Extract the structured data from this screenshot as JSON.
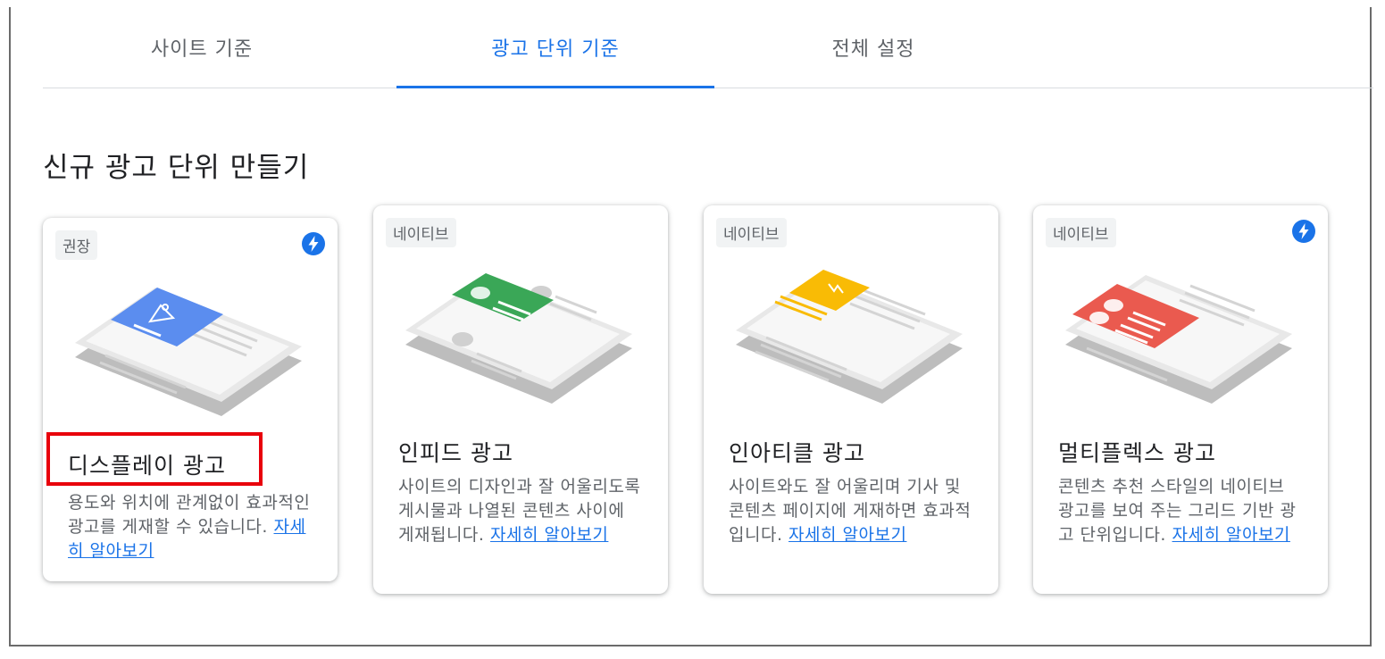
{
  "tabs": [
    {
      "label": "사이트 기준",
      "active": false
    },
    {
      "label": "광고 단위 기준",
      "active": true
    },
    {
      "label": "전체 설정",
      "active": false
    }
  ],
  "section_title": "신규 광고 단위 만들기",
  "colors": {
    "accent": "#1a73e8",
    "highlight": "#e8000b",
    "display_blue": "#5b8def",
    "infeed_green": "#3aa757",
    "inarticle_yellow": "#f9bb05",
    "multiplex_red": "#ea5a4f"
  },
  "cards": [
    {
      "badge": "권장",
      "amp_icon": "lightning-bolt-icon",
      "title": "디스플레이 광고",
      "description": "용도와 위치에 관계없이 효과적인 광고를 게재할 수 있습니다.",
      "link": "자세히 알아보기",
      "highlighted": true
    },
    {
      "badge": "네이티브",
      "title": "인피드 광고",
      "description": "사이트의 디자인과 잘 어울리도록 게시물과 나열된 콘텐츠 사이에 게재됩니다.",
      "link": "자세히 알아보기"
    },
    {
      "badge": "네이티브",
      "title": "인아티클 광고",
      "description": "사이트와도 잘 어울리며 기사 및 콘텐츠 페이지에 게재하면 효과적입니다.",
      "link": "자세히 알아보기"
    },
    {
      "badge": "네이티브",
      "amp_icon": "lightning-bolt-icon",
      "title": "멀티플렉스 광고",
      "description": "콘텐츠 추천 스타일의 네이티브 광고를 보여 주는 그리드 기반 광고 단위입니다.",
      "link": "자세히 알아보기"
    }
  ]
}
